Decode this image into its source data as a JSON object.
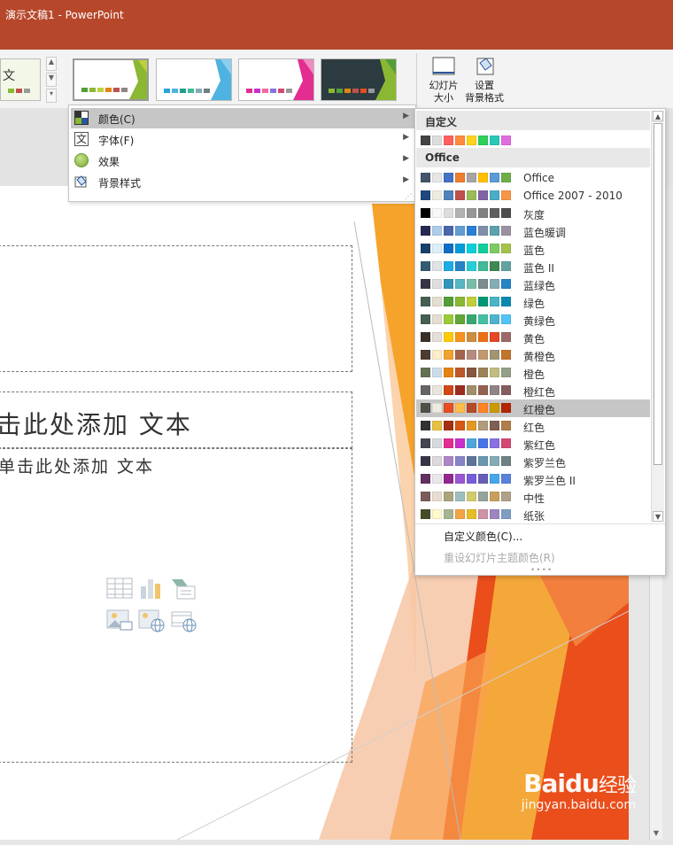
{
  "window": {
    "title": "演示文稿1 - PowerPoint"
  },
  "ribbon": {
    "partial_theme_text": "文",
    "slide_size_label": "幻灯片\n大小",
    "format_background_label": "设置\n背景格式"
  },
  "menu": {
    "items": [
      {
        "label": "颜色(C)",
        "icon": "color-icon",
        "has_submenu": true,
        "highlighted": true
      },
      {
        "label": "字体(F)",
        "icon": "font-icon",
        "has_submenu": true
      },
      {
        "label": "效果",
        "icon": "effects-icon",
        "has_submenu": true
      },
      {
        "label": "背景样式",
        "icon": "background-style-icon",
        "has_submenu": true
      }
    ]
  },
  "colors_flyout": {
    "custom_header": "自定义",
    "custom_swatch": [
      "#444444",
      "#dddddd",
      "#ff5f5f",
      "#ff8b40",
      "#ffd21e",
      "#2fd05a",
      "#29c9b8",
      "#e06de0"
    ],
    "office_header": "Office",
    "selected": "红橙色",
    "schemes": [
      {
        "name": "Office",
        "colors": [
          "#44546a",
          "#e7e6e6",
          "#4472c4",
          "#ed7d31",
          "#a5a5a5",
          "#ffc000",
          "#5b9bd5",
          "#70ad47"
        ]
      },
      {
        "name": "Office 2007 - 2010",
        "colors": [
          "#1f497d",
          "#eeece1",
          "#4f81bd",
          "#c0504d",
          "#9bbb59",
          "#8064a2",
          "#4bacc6",
          "#f79646"
        ]
      },
      {
        "name": "灰度",
        "colors": [
          "#000000",
          "#f8f8f8",
          "#dddddd",
          "#b2b2b2",
          "#969696",
          "#808080",
          "#5f5f5f",
          "#4d4d4d"
        ]
      },
      {
        "name": "蓝色暖调",
        "colors": [
          "#242852",
          "#acccea",
          "#4a66ac",
          "#629dd1",
          "#297fd5",
          "#7f8fa9",
          "#5aa2ae",
          "#9d90a0"
        ]
      },
      {
        "name": "蓝色",
        "colors": [
          "#17406d",
          "#dbeff9",
          "#0f6fc6",
          "#009dd9",
          "#0bd0d9",
          "#10cf9b",
          "#7cca62",
          "#a5c249"
        ]
      },
      {
        "name": "蓝色 II",
        "colors": [
          "#335b74",
          "#dfe3e5",
          "#1cade4",
          "#2683c6",
          "#27ced7",
          "#42ba97",
          "#3e8853",
          "#62a39f"
        ]
      },
      {
        "name": "蓝绿色",
        "colors": [
          "#373545",
          "#dedede",
          "#3494ba",
          "#58b6c0",
          "#75bda7",
          "#7a8c8e",
          "#84acb6",
          "#2683c6"
        ]
      },
      {
        "name": "绿色",
        "colors": [
          "#455f51",
          "#e3ded1",
          "#549e39",
          "#8ab833",
          "#c0cf3a",
          "#029676",
          "#4ab5c4",
          "#0989b1"
        ]
      },
      {
        "name": "黄绿色",
        "colors": [
          "#455f51",
          "#e3ded1",
          "#99cb38",
          "#63a537",
          "#37a76f",
          "#44c1a3",
          "#4eb3cf",
          "#51c3f9"
        ]
      },
      {
        "name": "黄色",
        "colors": [
          "#39302a",
          "#e5dedb",
          "#ffca08",
          "#f8931d",
          "#ce8d3e",
          "#ec7016",
          "#e64823",
          "#9c6a6a"
        ]
      },
      {
        "name": "黄橙色",
        "colors": [
          "#4e3b30",
          "#fbeec9",
          "#f0a22e",
          "#a5644e",
          "#b58b80",
          "#c3986d",
          "#a19574",
          "#c17529"
        ]
      },
      {
        "name": "橙色",
        "colors": [
          "#637052",
          "#ccddea",
          "#e48312",
          "#bd582c",
          "#865640",
          "#9b8357",
          "#c2bc80",
          "#94a088"
        ]
      },
      {
        "name": "橙红色",
        "colors": [
          "#696464",
          "#e9e5dc",
          "#d34817",
          "#9b2d1f",
          "#a28e6a",
          "#956251",
          "#918485",
          "#855d5d"
        ]
      },
      {
        "name": "红橙色",
        "colors": [
          "#505046",
          "#eeece1",
          "#e84c22",
          "#ffbd47",
          "#b64926",
          "#ff8427",
          "#cc9900",
          "#b22600"
        ]
      },
      {
        "name": "红色",
        "colors": [
          "#323232",
          "#e5c243",
          "#a5300f",
          "#d55816",
          "#e19825",
          "#b19c7d",
          "#7f5f52",
          "#b27d49"
        ]
      },
      {
        "name": "紫红色",
        "colors": [
          "#454551",
          "#d8d9dc",
          "#e32d91",
          "#c830cc",
          "#4ea6dc",
          "#4775e7",
          "#8971e1",
          "#d54773"
        ]
      },
      {
        "name": "紫罗兰色",
        "colors": [
          "#373545",
          "#dcd8dc",
          "#ad84c6",
          "#8784c7",
          "#5d739a",
          "#6997af",
          "#84acb6",
          "#6f8183"
        ]
      },
      {
        "name": "紫罗兰色 II",
        "colors": [
          "#632e62",
          "#eae5eb",
          "#92278f",
          "#9b57d3",
          "#755dd9",
          "#665eb8",
          "#45a5ed",
          "#5982db"
        ]
      },
      {
        "name": "中性",
        "colors": [
          "#7a5d58",
          "#e9dcd0",
          "#a9a57c",
          "#9cbebd",
          "#d2cb6c",
          "#95a39d",
          "#c89f5d",
          "#b1a089"
        ]
      },
      {
        "name": "纸张",
        "colors": [
          "#444d26",
          "#fefac9",
          "#a5b592",
          "#f3a447",
          "#e7bc29",
          "#d092a7",
          "#9c85c0",
          "#809ec2"
        ]
      }
    ],
    "customize_label": "自定义颜色(C)...",
    "reset_label": "重设幻灯片主题颜色(R)"
  },
  "slide": {
    "title_placeholder": "击此处添加 文本",
    "subtitle_placeholder": "单击此处添加 文本"
  },
  "watermark": {
    "brand": "Baidu",
    "brand_cn": "经验",
    "url": "jingyan.baidu.com"
  }
}
